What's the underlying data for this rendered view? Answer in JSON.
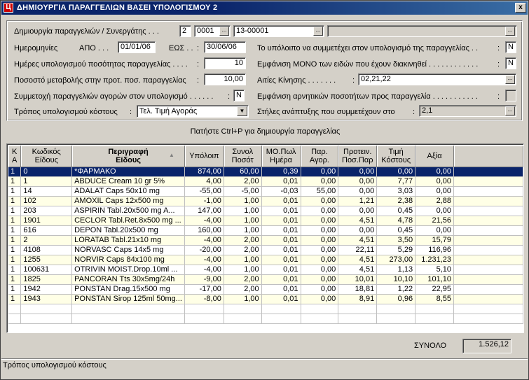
{
  "window": {
    "title": "ΔΗΜΙΟΥΡΓΙΑ ΠΑΡΑΓΓΕΛΙΩΝ ΒΑΣΕΙ ΥΠΟΛΟΓΙΣΜΟΥ 2",
    "close": "x"
  },
  "form": {
    "partner_label": "Δημιουργία παραγγελιών / Συνεργάτης . . .",
    "partner_num": "2",
    "partner_code": "0001",
    "partner_id": "13-00001",
    "partner_name": "",
    "dates_label": "Ημερομηνίες",
    "from_label": "ΑΠΟ . . .",
    "from_value": "01/01/06",
    "to_label": "ΕΩΣ . .",
    "to_value": "30/06/06",
    "days_label": "Ημέρες υπολογισμού ποσότητας παραγγελίας . . . .",
    "days_value": "10",
    "pct_label": "Ποσοστό μεταβολής στην προτ. ποσ. παραγγελίας",
    "pct_value": "10,00",
    "buy_orders_label": "Συμμετοχή παραγγελιών αγορών στον υπολογισμό . . . . . .",
    "buy_orders_value": "N",
    "cost_method_label": "Τρόπος υπολογισμού κόστους",
    "cost_method_value": "Τελ. Τιμή Αγοράς",
    "balance_label": "Το υπόλοιπο να συμμετέχει στον υπολογισμό της παραγγελίας . .",
    "balance_value": "N",
    "only_distributed_label": "Εμφάνιση ΜΟΝΟ των ειδών που έχουν διακινηθεί . . . . . . . . . . . .",
    "only_distributed_value": "N",
    "reasons_label": "Αιτίες Κίνησης . . . . . . .",
    "reasons_value": "02,21,22",
    "negative_label": "Εμφάνιση αρνητικών ποσοτήτων προς παραγγελία . . . . . . . . . . .",
    "negative_value": "",
    "columns_label": "Στήλες ανάπτυξης που συμμετέχουν στο",
    "columns_value": "2,1",
    "colon": ":"
  },
  "hint": "Πατήστε Ctrl+P για δημιουργία παραγγελίας",
  "table": {
    "headers": [
      "Κ\nΑ",
      "Κωδικός\nΕίδους",
      "Περιγραφή\nΕίδους",
      "Υπόλοιπ",
      "Συνολ\nΠοσότ",
      "ΜΟ.Πωλ\nΗμέρα",
      "Παρ.\nΑγορ.",
      "Προτειν.\nΠοσ.Παρ",
      "Τιμή\nΚόστους",
      "Αξία"
    ],
    "rows": [
      [
        "1",
        "0",
        "*ΦΑΡΜΑΚΟ",
        "874,00",
        "60,00",
        "0,39",
        "0,00",
        "0,00",
        "0,00",
        "0,00"
      ],
      [
        "1",
        "1",
        "ABDUCE Cream 10 gr  5%",
        "4,00",
        "2,00",
        "0,01",
        "0,00",
        "0,00",
        "7,77",
        "0,00"
      ],
      [
        "1",
        "14",
        "ADALAT Caps 50x10 mg",
        "-55,00",
        "-5,00",
        "-0,03",
        "55,00",
        "0,00",
        "3,03",
        "0,00"
      ],
      [
        "1",
        "102",
        "AMOXIL Caps 12x500 mg",
        "-1,00",
        "1,00",
        "0,01",
        "0,00",
        "1,21",
        "2,38",
        "2,88"
      ],
      [
        "1",
        "203",
        "ASPIRIN  Tabl.20x500 mg A...",
        "147,00",
        "1,00",
        "0,01",
        "0,00",
        "0,00",
        "0,45",
        "0,00"
      ],
      [
        "1",
        "1901",
        "CECLOR Tabl.Ret.8x500 mg ...",
        "-4,00",
        "1,00",
        "0,01",
        "0,00",
        "4,51",
        "4,78",
        "21,56"
      ],
      [
        "1",
        "616",
        "DEPON  Tabl.20x500 mg",
        "160,00",
        "1,00",
        "0,01",
        "0,00",
        "0,00",
        "0,45",
        "0,00"
      ],
      [
        "1",
        "2",
        "LORATAB Tabl.21x10 mg",
        "-4,00",
        "2,00",
        "0,01",
        "0,00",
        "4,51",
        "3,50",
        "15,79"
      ],
      [
        "1",
        "4108",
        "NORVASC  Caps 14x5 mg",
        "-20,00",
        "2,00",
        "0,01",
        "0,00",
        "22,11",
        "5,29",
        "116,96"
      ],
      [
        "1",
        "1255",
        "NORVIR Caps 84x100 mg",
        "-4,00",
        "1,00",
        "0,01",
        "0,00",
        "4,51",
        "273,00",
        "1.231,23"
      ],
      [
        "1",
        "100631",
        "OTRIVIN MOIST.Drop.10ml ...",
        "-4,00",
        "1,00",
        "0,01",
        "0,00",
        "4,51",
        "1,13",
        "5,10"
      ],
      [
        "1",
        "1825",
        "PANCORAN  Tts 30x5mg/24h",
        "-9,00",
        "2,00",
        "0,01",
        "0,00",
        "10,01",
        "10,10",
        "101,10"
      ],
      [
        "1",
        "1942",
        "PONSTAN Drag.15x500 mg",
        "-17,00",
        "2,00",
        "0,01",
        "0,00",
        "18,81",
        "1,22",
        "22,95"
      ],
      [
        "1",
        "1943",
        "PONSTAN Sirop 125ml 50mg...",
        "-8,00",
        "1,00",
        "0,01",
        "0,00",
        "8,91",
        "0,96",
        "8,55"
      ]
    ]
  },
  "total": {
    "label": "ΣΥΝΟΛΟ",
    "value": "1.526,12"
  },
  "status": "Τρόπος υπολογισμού κόστους",
  "icons": {
    "ellipsis": "...",
    "dropdown": "▼",
    "sort": "▲",
    "app": "Ц"
  }
}
